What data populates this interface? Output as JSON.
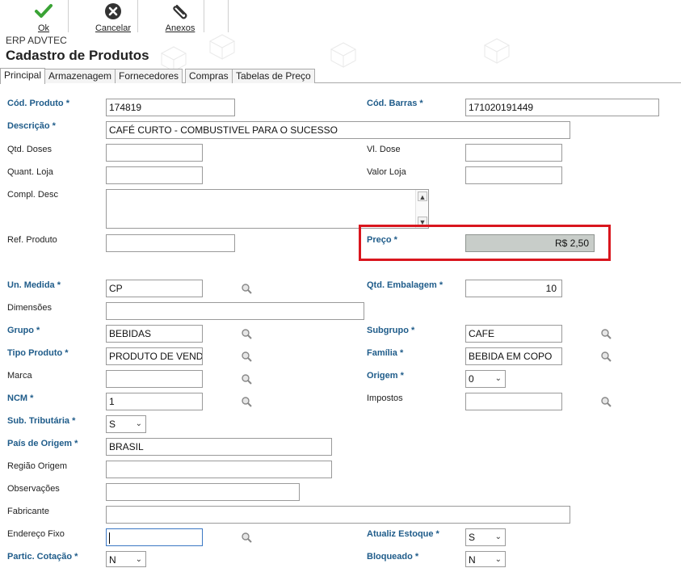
{
  "toolbar": {
    "ok_label": "Ok",
    "cancel_label": "Cancelar",
    "attachments_label": "Anexos"
  },
  "app": {
    "name": "ERP ADVTEC",
    "title": "Cadastro de Produtos"
  },
  "tabs": [
    "Principal",
    "Armazenagem",
    "Fornecedores",
    "Compras",
    "Tabelas de Preço"
  ],
  "colors": {
    "required_label": "#1f5c8a",
    "highlight": "#d9161e",
    "ok_icon": "#3aa335"
  },
  "fields": {
    "cod_produto": {
      "label": "Cód. Produto *",
      "value": "174819"
    },
    "cod_barras": {
      "label": "Cód. Barras *",
      "value": "171020191449"
    },
    "descricao": {
      "label": "Descrição *",
      "value": "CAFÉ CURTO - COMBUSTIVEL PARA O SUCESSO"
    },
    "qtd_doses": {
      "label": "Qtd. Doses",
      "value": ""
    },
    "vl_dose": {
      "label": "Vl. Dose",
      "value": ""
    },
    "quant_loja": {
      "label": "Quant. Loja",
      "value": ""
    },
    "valor_loja": {
      "label": "Valor Loja",
      "value": ""
    },
    "compl_desc": {
      "label": "Compl. Desc",
      "value": ""
    },
    "ref_produto": {
      "label": "Ref. Produto",
      "value": ""
    },
    "preco": {
      "label": "Preço *",
      "value": "R$ 2,50"
    },
    "un_medida": {
      "label": "Un. Medida *",
      "value": "CP"
    },
    "qtd_embalagem": {
      "label": "Qtd. Embalagem *",
      "value": "10"
    },
    "dimensoes": {
      "label": "Dimensões",
      "value": ""
    },
    "grupo": {
      "label": "Grupo *",
      "value": "BEBIDAS"
    },
    "subgrupo": {
      "label": "Subgrupo *",
      "value": "CAFE"
    },
    "tipo_produto": {
      "label": "Tipo Produto *",
      "value": "PRODUTO DE VENDA"
    },
    "familia": {
      "label": "Família *",
      "value": "BEBIDA EM COPO"
    },
    "marca": {
      "label": "Marca",
      "value": ""
    },
    "origem": {
      "label": "Origem *",
      "value": "0"
    },
    "ncm": {
      "label": "NCM *",
      "value": "1"
    },
    "impostos": {
      "label": "Impostos",
      "value": ""
    },
    "sub_tributaria": {
      "label": "Sub. Tributária *",
      "value": "S"
    },
    "pais_origem": {
      "label": "País de Origem *",
      "value": "BRASIL"
    },
    "regiao_origem": {
      "label": "Região Origem",
      "value": ""
    },
    "observacoes": {
      "label": "Observações",
      "value": ""
    },
    "fabricante": {
      "label": "Fabricante",
      "value": ""
    },
    "endereco_fixo": {
      "label": "Endereço Fixo",
      "value": ""
    },
    "atualiz_estoque": {
      "label": "Atualiz Estoque *",
      "value": "S"
    },
    "partic_cotacao": {
      "label": "Partic. Cotação *",
      "value": "N"
    },
    "bloqueado": {
      "label": "Bloqueado *",
      "value": "N"
    }
  }
}
